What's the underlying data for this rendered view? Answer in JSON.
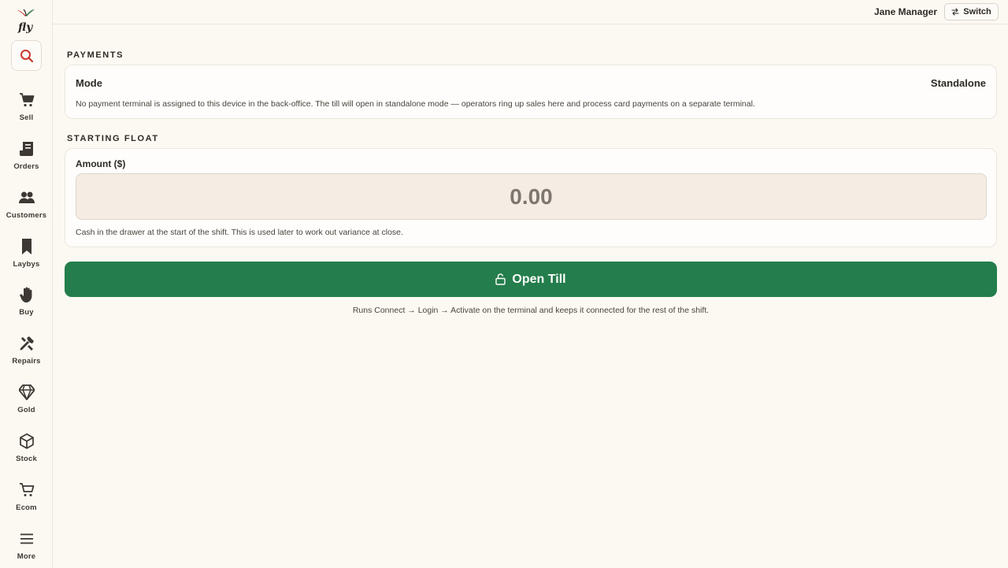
{
  "sidebar": {
    "logo_text": "fly",
    "items": [
      {
        "label": "Sell",
        "icon": "cart-icon"
      },
      {
        "label": "Orders",
        "icon": "receipt-icon"
      },
      {
        "label": "Customers",
        "icon": "users-icon"
      },
      {
        "label": "Laybys",
        "icon": "bookmark-icon"
      },
      {
        "label": "Buy",
        "icon": "hand-icon"
      },
      {
        "label": "Repairs",
        "icon": "tools-icon"
      },
      {
        "label": "Gold",
        "icon": "diamond-icon"
      },
      {
        "label": "Stock",
        "icon": "box-icon"
      },
      {
        "label": "Ecom",
        "icon": "shopping-cart-icon"
      },
      {
        "label": "More",
        "icon": "menu-icon"
      }
    ]
  },
  "header": {
    "user_name": "Jane Manager",
    "switch_label": "Switch"
  },
  "payments": {
    "section_title": "PAYMENTS",
    "mode_label": "Mode",
    "mode_value": "Standalone",
    "help_text": "No payment terminal is assigned to this device in the back-office. The till will open in standalone mode — operators ring up sales here and process card payments on a separate terminal."
  },
  "starting_float": {
    "section_title": "STARTING FLOAT",
    "amount_label": "Amount ($)",
    "amount_value": "0.00",
    "help_text": "Cash in the drawer at the start of the shift. This is used later to work out variance at close."
  },
  "open_till": {
    "label": "Open Till",
    "footnote": "Runs Connect → Login → Activate on the terminal and keeps it connected for the rest of the shift."
  },
  "colors": {
    "background": "#fcf9f3",
    "primary_button": "#247d4c",
    "accent_red": "#c8372d",
    "icon_dark": "#3d3833"
  }
}
